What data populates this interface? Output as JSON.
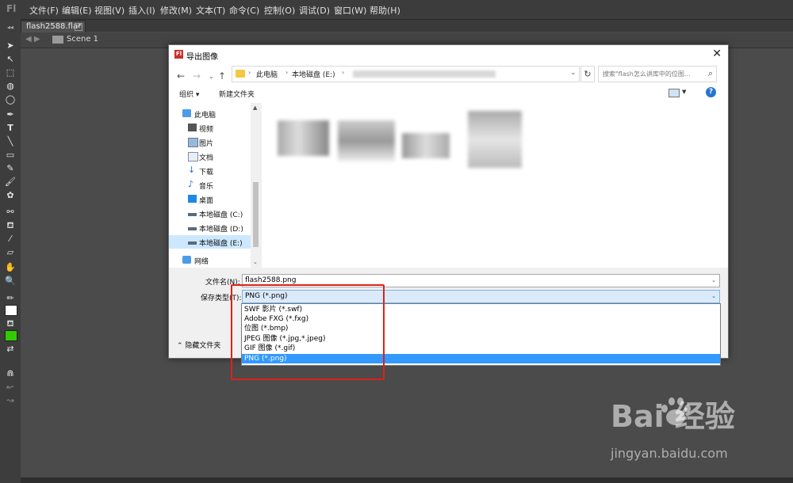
{
  "app": {
    "logo": "Fl",
    "menu": [
      "文件(F)",
      "编辑(E)",
      "视图(V)",
      "插入(I)",
      "修改(M)",
      "文本(T)",
      "命令(C)",
      "控制(O)",
      "调试(D)",
      "窗口(W)",
      "帮助(H)"
    ],
    "document_tab": "flash2588.fla*",
    "scene_label": "Scene 1"
  },
  "dialog": {
    "title": "导出图像",
    "breadcrumb": [
      "此电脑",
      "本地磁盘 (E:)"
    ],
    "search_placeholder": "搜索\"flash怎么讲库中的位图...",
    "organize_label": "组织 ▾",
    "new_folder_label": "新建文件夹",
    "nav_items": [
      {
        "label": "此电脑",
        "icon": "computer-icon"
      },
      {
        "label": "视频",
        "icon": "video-icon"
      },
      {
        "label": "图片",
        "icon": "pictures-icon"
      },
      {
        "label": "文档",
        "icon": "documents-icon"
      },
      {
        "label": "下载",
        "icon": "download-icon"
      },
      {
        "label": "音乐",
        "icon": "music-icon"
      },
      {
        "label": "桌面",
        "icon": "desktop-icon"
      },
      {
        "label": "本地磁盘 (C:)",
        "icon": "drive-icon"
      },
      {
        "label": "本地磁盘 (D:)",
        "icon": "drive-icon"
      },
      {
        "label": "本地磁盘 (E:)",
        "icon": "drive-icon",
        "selected": true
      },
      {
        "label": "网络",
        "icon": "network-icon"
      }
    ],
    "filename_label": "文件名(N):",
    "filename_value": "flash2588.png",
    "filetype_label": "保存类型(T):",
    "filetype_value": "PNG (*.png)",
    "hide_folders_label": "隐藏文件夹",
    "filetype_options": [
      "SWF 影片 (*.swf)",
      "Adobe FXG (*.fxg)",
      "位图 (*.bmp)",
      "JPEG 图像 (*.jpg,*.jpeg)",
      "GIF 图像 (*.gif)",
      "PNG (*.png)"
    ],
    "selected_option_index": 5
  },
  "watermark": {
    "logo_text": "Bai  经验",
    "url": "jingyan.baidu.com"
  },
  "colors": {
    "highlight_box": "#e0201a",
    "selected_option": "#3399ff"
  }
}
